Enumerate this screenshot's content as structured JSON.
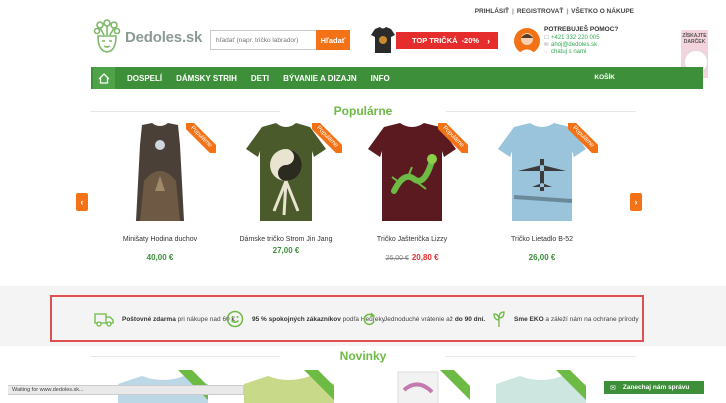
{
  "top_links": {
    "login": "PRIHLÁSIŤ",
    "register": "REGISTROVAŤ",
    "about": "VŠETKO O NÁKUPE"
  },
  "logo": {
    "text": "Dedoles.sk"
  },
  "search": {
    "placeholder": "hľadať (napr. tričko labrador)",
    "button": "Hľadať"
  },
  "promo": {
    "label": "TOP TRIČKÁ",
    "discount": "-20%",
    "chevron": "›"
  },
  "help": {
    "title": "POTREBUJEŠ POMOC?",
    "phone": "+421 332 220 005",
    "email": "ahoj@dedoles.sk",
    "chat": "chatuj s nami"
  },
  "gift": {
    "text": "ZÍSKAJTE DARČEK"
  },
  "nav": {
    "items": [
      "DOSPELÍ",
      "DÁMSKY STRIH",
      "DETI",
      "BÝVANIE A DIZAJN",
      "INFO"
    ],
    "cart": "KOŠÍK"
  },
  "popular": {
    "title": "Populárne",
    "ribbon": "Populárne",
    "products": [
      {
        "name": "Minišaty Hodina duchov",
        "price": "40,00 €",
        "colors": {
          "shirt": "#4a4038",
          "accent": "#8a7968"
        }
      },
      {
        "name": "Dámske tričko Strom Jin Jang",
        "price": "27,00 €",
        "colors": {
          "shirt": "#4b5a2a",
          "accent": "#e8e4d0"
        }
      },
      {
        "name": "Tričko Jašterička Lizzy",
        "old_price": "26,00 €",
        "price": "20,80 €",
        "colors": {
          "shirt": "#5a1a20",
          "accent": "#6dba45"
        }
      },
      {
        "name": "Tričko Lietadlo B-52",
        "price": "26,00 €",
        "colors": {
          "shirt": "#9ac3dc",
          "accent": "#4a4a4a"
        }
      }
    ]
  },
  "carousel": {
    "prev": "‹",
    "next": "›"
  },
  "benefits": [
    {
      "bold": "Poštovné zdarma",
      "text": " pri nákupe nad 60 €",
      "icon": "truck-icon"
    },
    {
      "bold": "95 % spokojných zákazníkov",
      "text": " podľa Heureky",
      "icon": "smile-icon"
    },
    {
      "bold_end": "do 90 dní.",
      "text": "Jednoduché vrátenie až ",
      "icon": "refresh-icon"
    },
    {
      "bold": "Sme EKO",
      "text": " a záleží nám na ochrane prírody",
      "icon": "sprout-icon"
    }
  ],
  "news": {
    "title": "Novinky"
  },
  "status_bar": {
    "text": "Waiting for www.dedoles.sk..."
  },
  "chat_button": {
    "label": "Zanechaj nám správu"
  },
  "colors": {
    "green": "#3d8f3a",
    "light_green": "#6dba45",
    "orange": "#f47216",
    "red": "#e52d2d",
    "highlight_border": "#e05050"
  }
}
